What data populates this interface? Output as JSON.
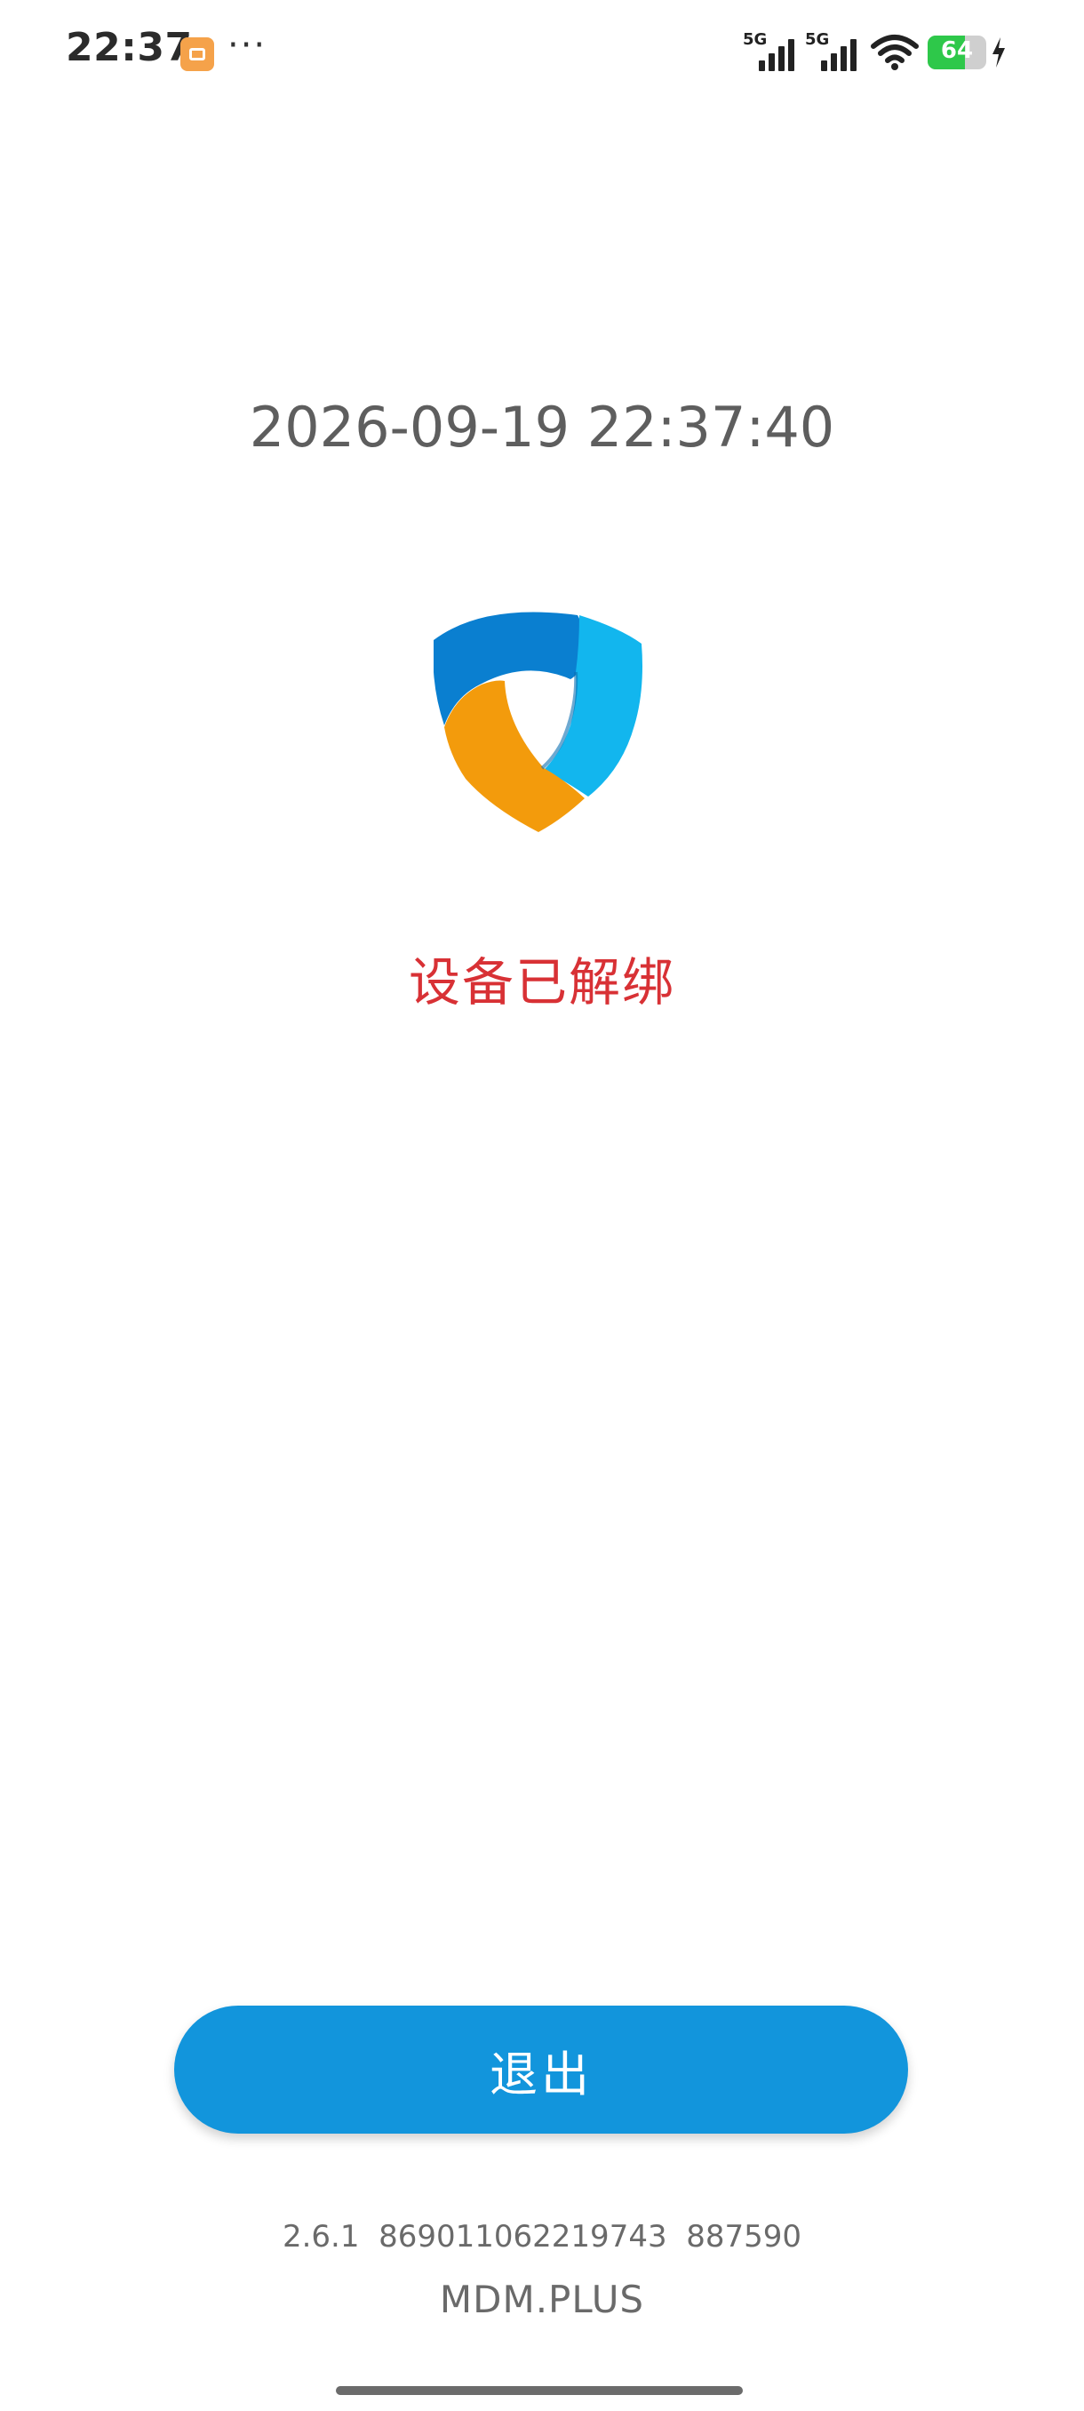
{
  "status_bar": {
    "time": "22:37",
    "notification_icon": "calendar-app-icon",
    "more_indicator": "···",
    "signal_1_label": "5G",
    "signal_2_label": "5G",
    "battery_percent": "64",
    "battery_level": 0.64,
    "charging": true
  },
  "main": {
    "datetime": "2026-09-19 22:37:40",
    "logo_icon": "shield-logo-icon",
    "status_message": "设备已解绑",
    "status_color": "#d83135"
  },
  "actions": {
    "exit_label": "退出",
    "button_color": "#1295dc"
  },
  "footer": {
    "version_info": "2.6.1  869011062219743  887590",
    "brand": "MDM.PLUS"
  }
}
